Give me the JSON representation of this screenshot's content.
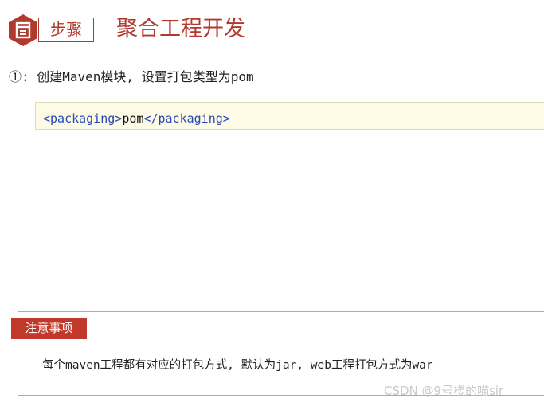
{
  "header": {
    "badge_icon": "document-hexagon-icon",
    "step_label": "步骤",
    "title": "聚合工程开发"
  },
  "instruction": "①: 创建Maven模块, 设置打包类型为pom",
  "code": {
    "open_tag": "<packaging>",
    "value": "pom",
    "close_tag": "</packaging>"
  },
  "note": {
    "label": "注意事项",
    "text": "每个maven工程都有对应的打包方式, 默认为jar, web工程打包方式为war"
  },
  "watermark": "CSDN @9号楼的喵sir",
  "colors": {
    "accent": "#b03a2e",
    "note_label_bg": "#c0392b",
    "code_bg": "#fdfbe5",
    "code_tag": "#2747b8"
  }
}
